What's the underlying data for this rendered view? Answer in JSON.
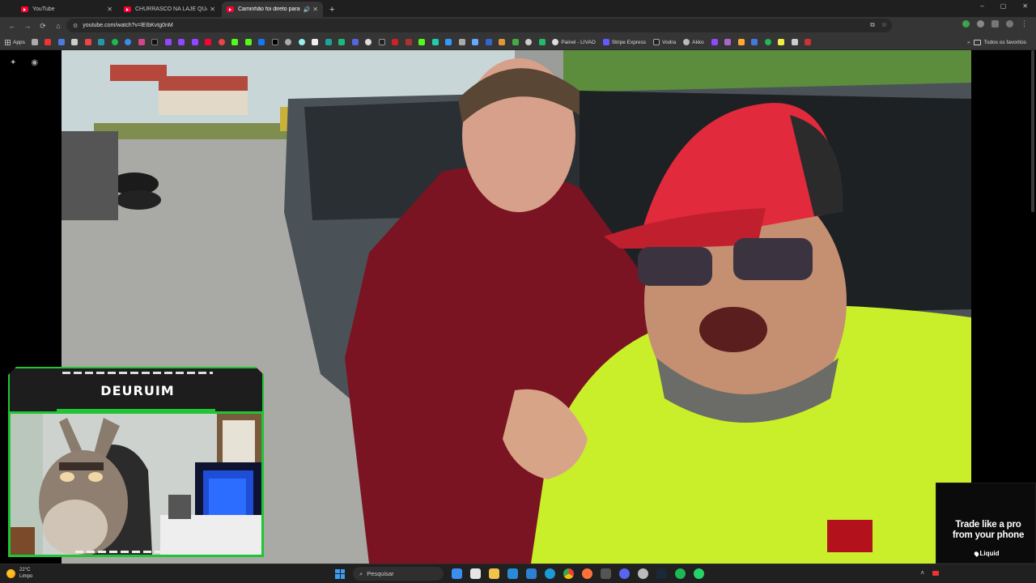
{
  "browser": {
    "tabs": [
      {
        "title": "YouTube",
        "active": false,
        "audio": false
      },
      {
        "title": "CHURRASCO NA LAJE QUASE DEU",
        "active": false,
        "audio": false
      },
      {
        "title": "Caminhão foi direto para a",
        "active": true,
        "audio": true
      }
    ],
    "new_tab_label": "+",
    "window_controls": [
      "–",
      "▢",
      "✕"
    ],
    "nav": {
      "back": "←",
      "forward": "→",
      "reload": "⟳",
      "home": "⌂"
    },
    "url": "youtube.com/watch?v=lEIbKvtg0nM",
    "bookmarks": {
      "apps_label": "Apps",
      "named": [
        "Painel - LIVAO",
        "Stripe Express",
        "Vodra",
        "Akko"
      ],
      "all_bookmarks_label": "Todos os favoritos"
    }
  },
  "overlay": {
    "streamer_name": "DEURUIM"
  },
  "ad": {
    "headline": "Trade like a pro from your phone",
    "brand": "Liquid"
  },
  "taskbar": {
    "temperature": "22°C",
    "condition": "Limpo",
    "search_placeholder": "Pesquisar"
  },
  "colors": {
    "accent_green": "#21c534",
    "youtube_red": "#ff0033"
  }
}
